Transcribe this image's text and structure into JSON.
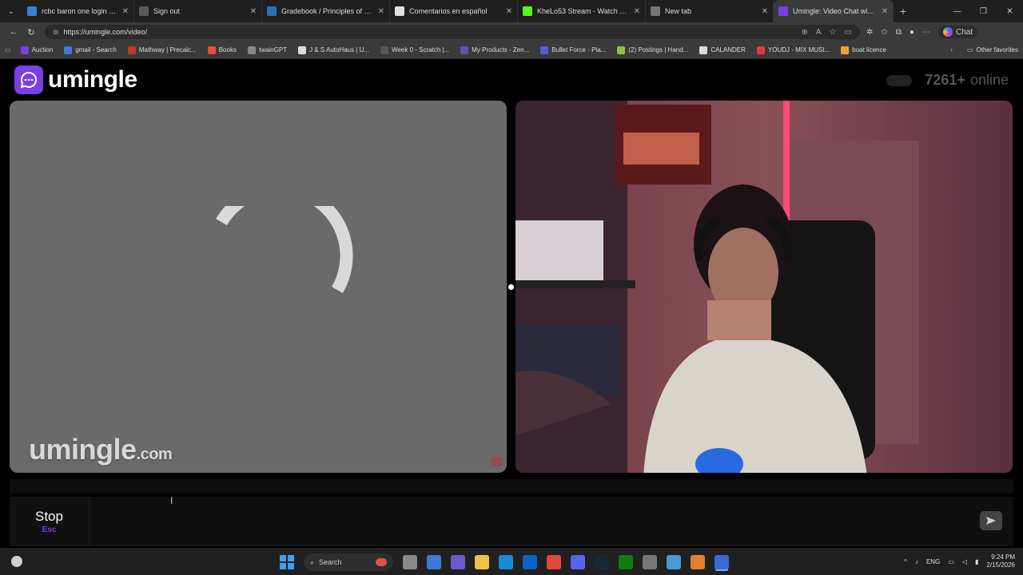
{
  "browser": {
    "tabs": [
      {
        "title": "rcbc baron one login - Search",
        "color": "#3c7dd9",
        "active": false
      },
      {
        "title": "Sign out",
        "color": "#5a5a5a",
        "active": false
      },
      {
        "title": "Gradebook / Principles of Sociolo...",
        "color": "#2a6fb8",
        "active": false
      },
      {
        "title": "Comentarios en español",
        "color": "#e0e0e0",
        "active": false
      },
      {
        "title": "KheLo53 Stream - Watch Live on K...",
        "color": "#53fc18",
        "active": false
      },
      {
        "title": "New tab",
        "color": "#777777",
        "active": false
      },
      {
        "title": "Umingle: Video Chat with St...",
        "color": "#7b3fe4",
        "active": true
      }
    ],
    "new_tab_glyph": "+",
    "url": "https://umingle.com/video/",
    "copilot_label": "Chat",
    "bookmarks": [
      {
        "label": "Auction",
        "color": "#7b3fe4"
      },
      {
        "label": "gmail - Search",
        "color": "#3c7dd9"
      },
      {
        "label": "Mathway | Precalc...",
        "color": "#c0392b"
      },
      {
        "label": "Books",
        "color": "#e74c3c"
      },
      {
        "label": "twainGPT",
        "color": "#888888"
      },
      {
        "label": "J & S AutoHaus | U...",
        "color": "#dddddd"
      },
      {
        "label": "Week 0 - Scratch |...",
        "color": "#555555"
      },
      {
        "label": "My Products - Zen...",
        "color": "#6a4fb0"
      },
      {
        "label": "Bullet Force · Pla...",
        "color": "#5a5adf"
      },
      {
        "label": "(2) Postings | Hand...",
        "color": "#8bc34a"
      },
      {
        "label": "CALANDER",
        "color": "#dddddd"
      },
      {
        "label": "YOUDJ - MIX MUSI...",
        "color": "#e53935"
      },
      {
        "label": "boat licence",
        "color": "#f0a030"
      }
    ],
    "other_favorites": "Other favorites"
  },
  "page": {
    "logo_text": "umingle",
    "online_count": "7261+",
    "online_label": "online",
    "watermark_main": "umingle",
    "watermark_suffix": ".com",
    "stop_label": "Stop",
    "stop_key": "Esc",
    "message_placeholder": "",
    "accent": "#7b3fe4"
  },
  "taskbar": {
    "search_label": "Search",
    "language": "ENG",
    "time": "9:24 PM",
    "date": "2/15/2026"
  }
}
